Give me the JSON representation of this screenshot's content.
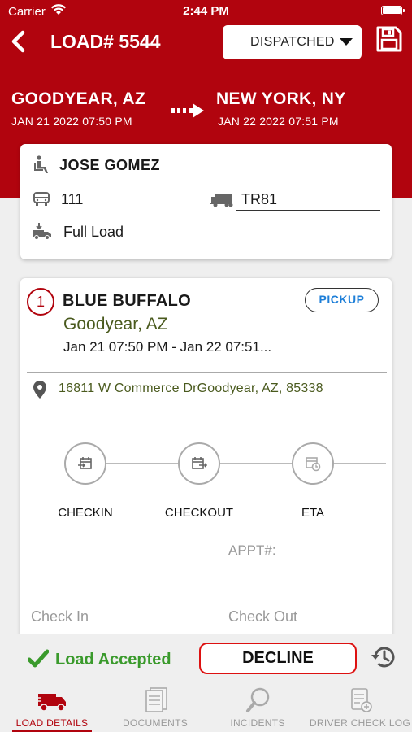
{
  "status_bar": {
    "carrier": "Carrier",
    "time": "2:44 PM"
  },
  "header": {
    "title": "LOAD# 5544",
    "status_value": "DISPATCHED",
    "background_color": "#b1040e"
  },
  "route": {
    "origin_city": "GOODYEAR, AZ",
    "origin_date": "JAN 21 2022 07:50 PM",
    "destination_city": "NEW YORK, NY",
    "destination_date": "JAN 22 2022 07:51 PM"
  },
  "driver_card": {
    "driver_name": "JOSE GOMEZ",
    "truck_number": "111",
    "trailer_number": "TR81",
    "load_type": "Full Load"
  },
  "stop": {
    "number": "1",
    "name": "BLUE BUFFALO",
    "city": "Goodyear, AZ",
    "time_range": "Jan 21 07:50 PM - Jan 22 07:51...",
    "badge": "PICKUP",
    "address": "16811 W Commerce DrGoodyear, AZ, 85338",
    "steps": [
      {
        "label": "CHECKIN",
        "icon": "checkin-icon"
      },
      {
        "label": "CHECKOUT",
        "icon": "checkout-icon"
      },
      {
        "label": "ETA",
        "icon": "eta-icon"
      }
    ],
    "appt_label": "APPT#:",
    "check_in_label": "Check In",
    "check_out_label": "Check Out"
  },
  "actions": {
    "accepted_text": "Load Accepted",
    "decline_label": "DECLINE",
    "accepted_color": "#3a9a2c",
    "decline_border_color": "#dd1111"
  },
  "tabs": [
    {
      "label": "LOAD DETAILS",
      "icon": "truck-icon",
      "active": true
    },
    {
      "label": "DOCUMENTS",
      "icon": "documents-icon",
      "active": false
    },
    {
      "label": "INCIDENTS",
      "icon": "magnifier-icon",
      "active": false
    },
    {
      "label": "DRIVER CHECK LOG",
      "icon": "check-log-icon",
      "active": false
    }
  ]
}
